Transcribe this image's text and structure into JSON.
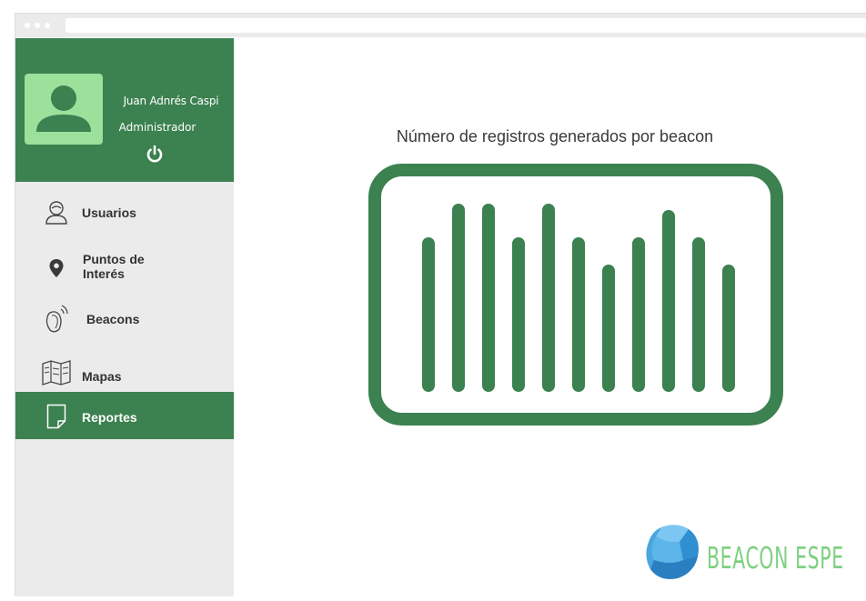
{
  "user": {
    "name": "Juan Adnrés Caspi",
    "role": "Administrador",
    "power_icon": "power-icon",
    "avatar_icon": "user-avatar-icon"
  },
  "nav": {
    "items": [
      {
        "label": "Usuarios",
        "icon": "user-icon",
        "active": false
      },
      {
        "label": "Puntos de Interés",
        "icon": "map-pin-icon",
        "active": false
      },
      {
        "label": "Beacons",
        "icon": "beacon-icon",
        "active": false
      },
      {
        "label": "Mapas",
        "icon": "map-icon",
        "active": false
      },
      {
        "label": "Reportes",
        "icon": "document-icon",
        "active": true
      }
    ]
  },
  "report": {
    "title": "Número de registros generados por beacon",
    "icon": "bar-chart-icon"
  },
  "brand": {
    "text": "BEACON ESPE"
  },
  "colors": {
    "primary_green": "#3c8150",
    "avatar_bg": "#9be19b",
    "sidebar_bg": "#ebebeb",
    "logo_green": "#7ed081",
    "logo_stone_blue": "#4aa5e0"
  }
}
